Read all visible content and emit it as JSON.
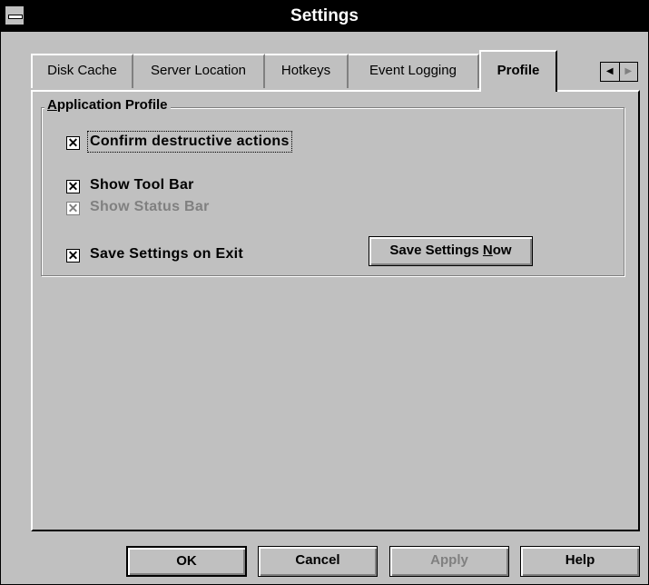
{
  "window": {
    "title": "Settings"
  },
  "tabs": [
    {
      "label": "Disk Cache",
      "active": false
    },
    {
      "label": "Server Location",
      "active": false
    },
    {
      "label": "Hotkeys",
      "active": false
    },
    {
      "label": "Event Logging",
      "active": false
    },
    {
      "label": "Profile",
      "active": true
    }
  ],
  "tab_scroll": {
    "left_icon": "left-arrow-icon",
    "right_icon": "right-arrow-icon"
  },
  "group": {
    "label_prefix": "A",
    "label_rest": "pplication Profile"
  },
  "checkboxes": {
    "confirm": {
      "label": "Confirm destructive actions",
      "checked": true,
      "enabled": true
    },
    "toolbar": {
      "label": "Show Tool Bar",
      "checked": true,
      "enabled": true
    },
    "statusbar": {
      "label": "Show Status Bar",
      "checked": true,
      "enabled": false
    },
    "save_on_exit": {
      "label": "Save Settings on Exit",
      "checked": true,
      "enabled": true
    }
  },
  "save_now": {
    "prefix": "Save Settings ",
    "mnemonic": "N",
    "suffix": "ow"
  },
  "buttons": {
    "ok": "OK",
    "cancel": "Cancel",
    "apply": "Apply",
    "help": "Help"
  },
  "glyphs": {
    "check": "✕"
  }
}
